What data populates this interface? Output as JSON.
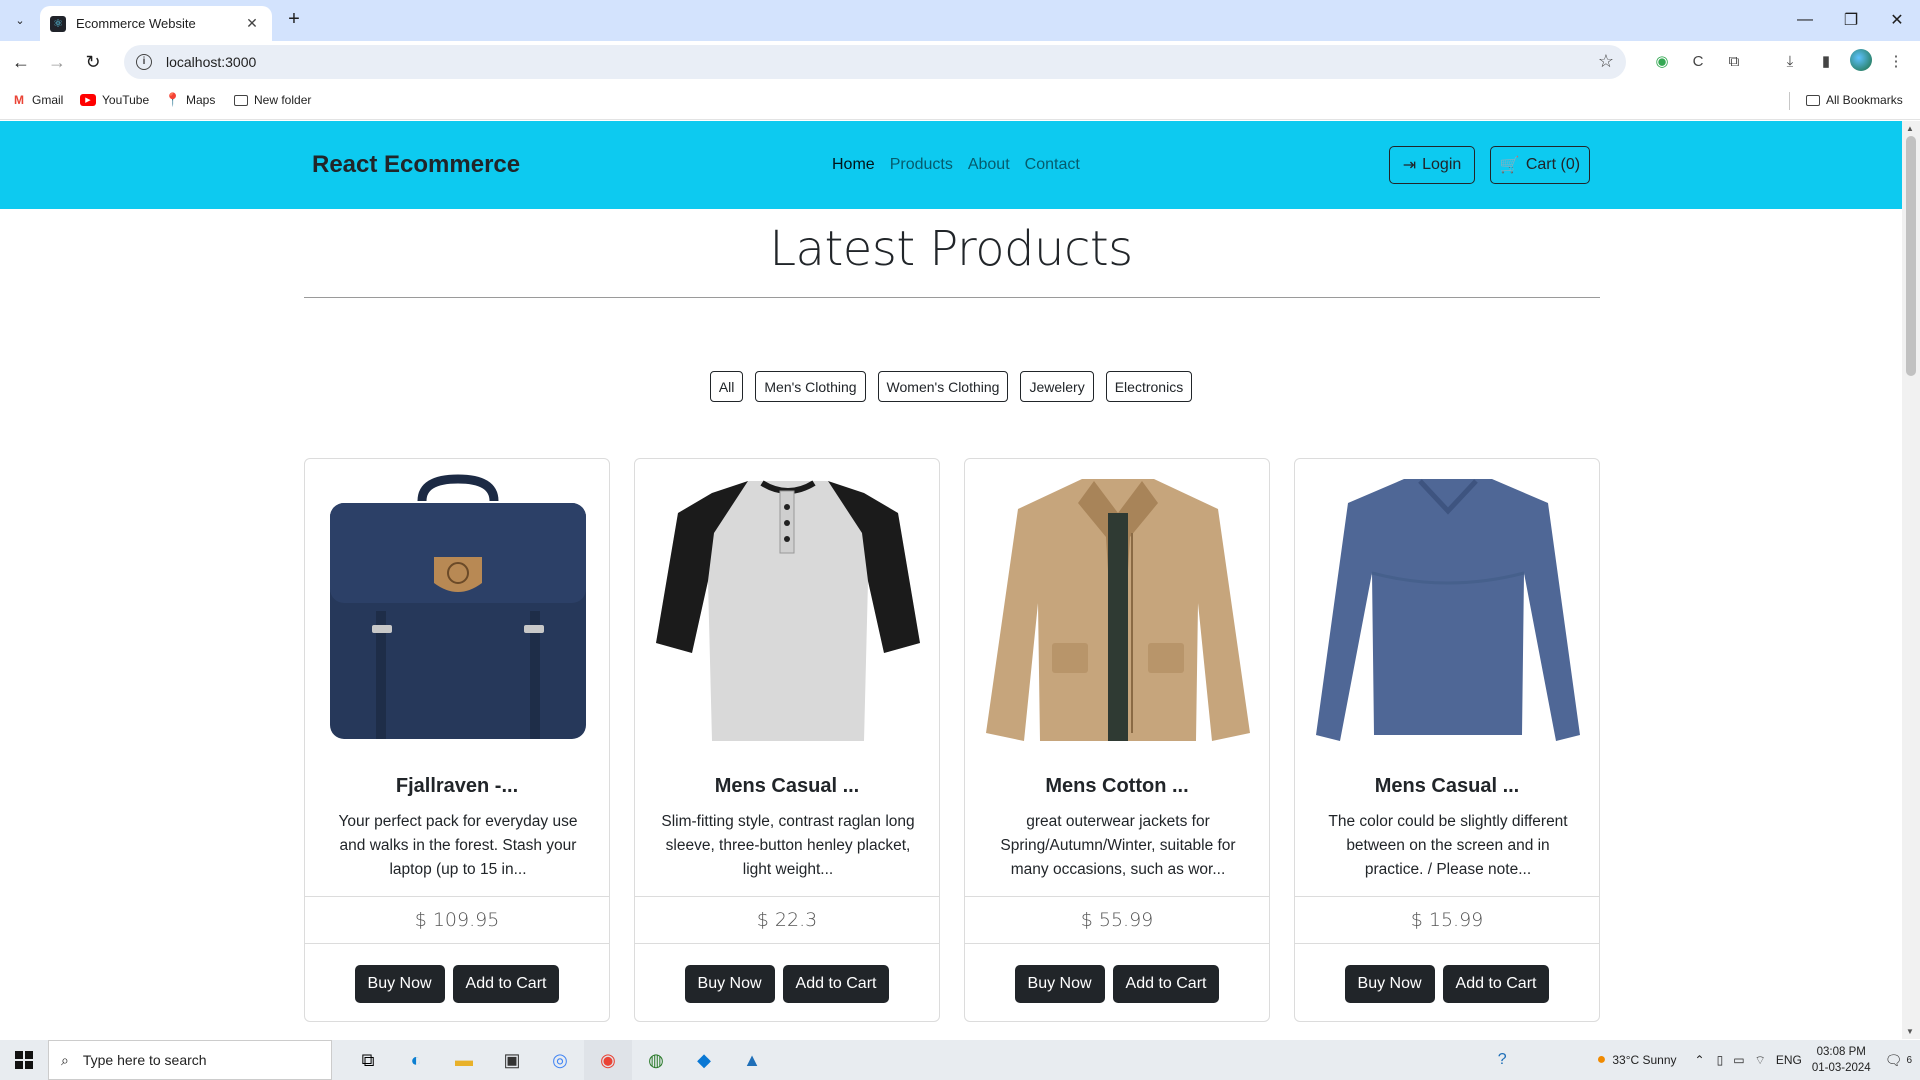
{
  "browser": {
    "tab_title": "Ecommerce Website",
    "tab_close": "✕",
    "new_tab": "+",
    "url": "localhost:3000",
    "window_controls": [
      "—",
      "❐",
      "✕"
    ]
  },
  "bookmarks": [
    {
      "label": "Gmail",
      "icon": "gmail-icon"
    },
    {
      "label": "YouTube",
      "icon": "youtube-icon"
    },
    {
      "label": "Maps",
      "icon": "maps-icon"
    },
    {
      "label": "New folder",
      "icon": "folder-icon"
    }
  ],
  "all_bookmarks": "All Bookmarks",
  "navbar": {
    "brand": "React Ecommerce",
    "links": [
      "Home",
      "Products",
      "About",
      "Contact"
    ],
    "active_link": "Home",
    "login_label": "Login",
    "cart_label": "Cart (0)",
    "bg_color": "#0dcaf0"
  },
  "heading": "Latest Products",
  "filters": [
    "All",
    "Men's Clothing",
    "Women's Clothing",
    "Jewelery",
    "Electronics"
  ],
  "products": [
    {
      "title": "Fjallraven -...",
      "description": "Your perfect pack for everyday use and walks in the forest. Stash your laptop (up to 15 in...",
      "price": "$ 109.95",
      "image": "backpack-image"
    },
    {
      "title": "Mens Casual ...",
      "description": "Slim-fitting style, contrast raglan long sleeve, three-button henley placket, light weight...",
      "price": "$ 22.3",
      "image": "henley-tshirt-image"
    },
    {
      "title": "Mens Cotton ...",
      "description": "great outerwear jackets for Spring/Autumn/Winter, suitable for many occasions, such as wor...",
      "price": "$ 55.99",
      "image": "cotton-jacket-image"
    },
    {
      "title": "Mens Casual ...",
      "description": "The color could be slightly different between on the screen and in practice. / Please note...",
      "price": "$ 15.99",
      "image": "longsleeve-shirt-image"
    }
  ],
  "buttons": {
    "buy_now": "Buy Now",
    "add_to_cart": "Add to Cart"
  },
  "taskbar": {
    "search_placeholder": "Type here to search",
    "weather": "33°C  Sunny",
    "language": "ENG",
    "time": "03:08 PM",
    "date": "01-03-2024",
    "notifications": "6"
  }
}
